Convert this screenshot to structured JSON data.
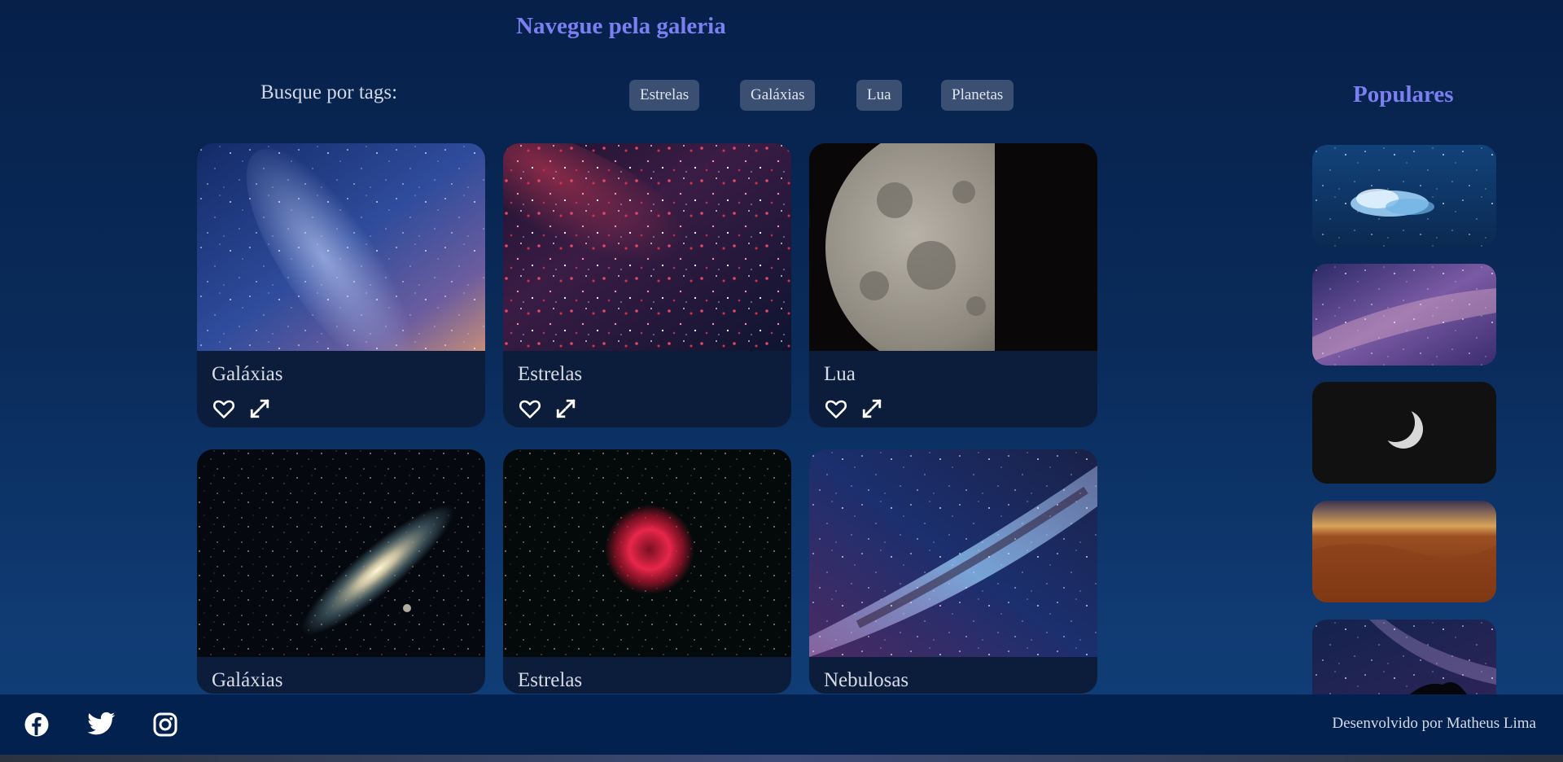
{
  "header": {
    "title": "Navegue pela galeria"
  },
  "tags": {
    "label": "Busque por tags:",
    "items": [
      "Estrelas",
      "Galáxias",
      "Lua",
      "Planetas"
    ]
  },
  "gallery": {
    "cards": [
      {
        "title": "Galáxias",
        "image": "milky-way-blue-purple"
      },
      {
        "title": "Estrelas",
        "image": "red-star-field"
      },
      {
        "title": "Lua",
        "image": "half-moon"
      },
      {
        "title": "Galáxias",
        "image": "andromeda-galaxy"
      },
      {
        "title": "Estrelas",
        "image": "rosette-nebula"
      },
      {
        "title": "Nebulosas",
        "image": "milky-way-band"
      }
    ],
    "action_icons": [
      "heart-icon",
      "expand-icon"
    ]
  },
  "popular": {
    "title": "Populares",
    "thumbnails": [
      "night-cloud",
      "galaxy-purple",
      "crescent-moon",
      "desert-night",
      "milky-way-silhouette"
    ]
  },
  "footer": {
    "social": [
      "facebook-icon",
      "twitter-icon",
      "instagram-icon"
    ],
    "credit": "Desenvolvido por Matheus Lima"
  },
  "colors": {
    "accent": "#7b7ff0",
    "background": "#0a2b5a",
    "tag_background": "#3a4f72",
    "footer_background": "#03214f"
  }
}
